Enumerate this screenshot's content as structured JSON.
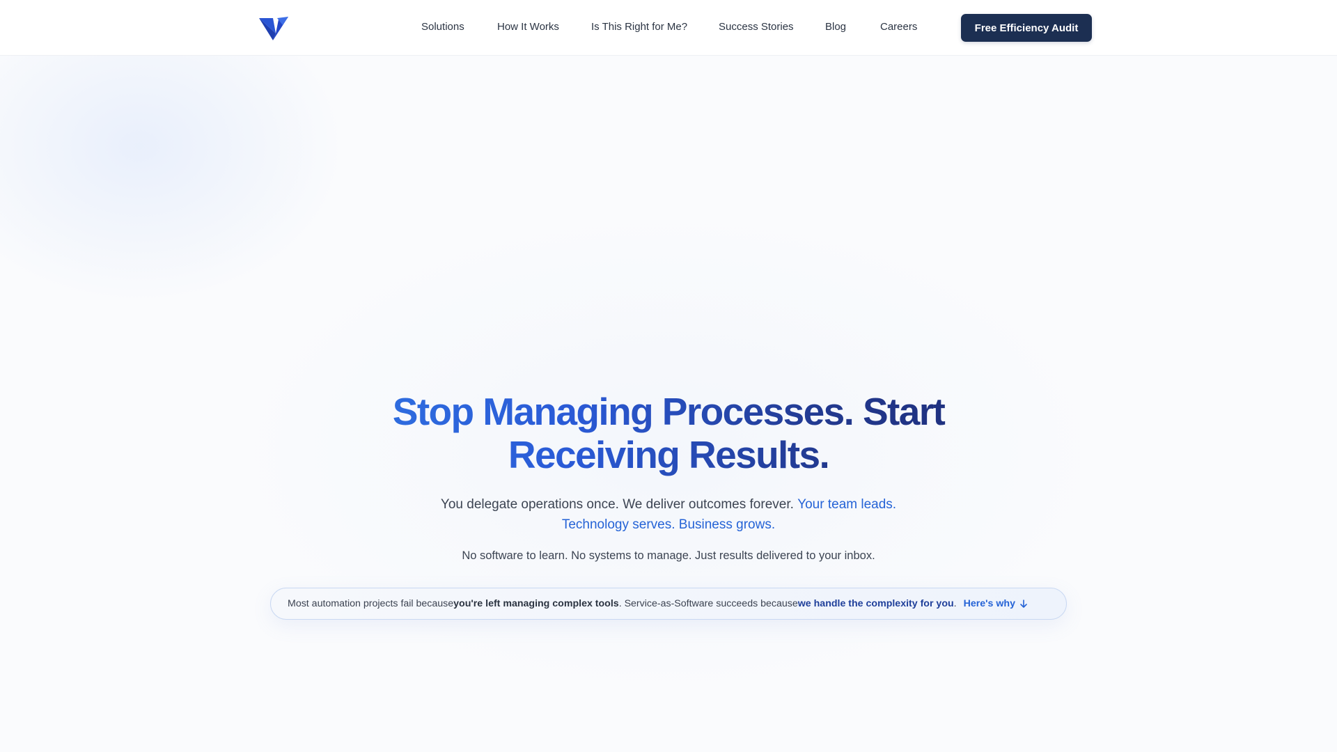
{
  "header": {
    "nav": [
      {
        "label": "Solutions"
      },
      {
        "label": "How It Works"
      },
      {
        "label": "Is This Right for Me?"
      },
      {
        "label": "Success Stories"
      },
      {
        "label": "Blog"
      },
      {
        "label": "Careers"
      }
    ],
    "cta_label": "Free Efficiency Audit"
  },
  "hero": {
    "title": "Stop Managing Processes. Start Receiving Results.",
    "subtitle_plain": "You delegate operations once. We deliver outcomes forever. ",
    "subtitle_accent": "Your team leads. Technology serves. Business grows.",
    "note": "No software to learn. No systems to manage. Just results delivered to your inbox."
  },
  "banner": {
    "part1": "Most automation projects fail because ",
    "bold1": "you're left managing complex tools",
    "part2": ". Service-as-Software succeeds because ",
    "bold2": "we handle the complexity for you",
    "part3": ".",
    "link_label": "Here's why",
    "link_icon": "arrow-down-icon"
  },
  "colors": {
    "brand_dark": "#1c2f52",
    "accent_blue": "#2563d6",
    "logo_blue": "#2346c8"
  }
}
